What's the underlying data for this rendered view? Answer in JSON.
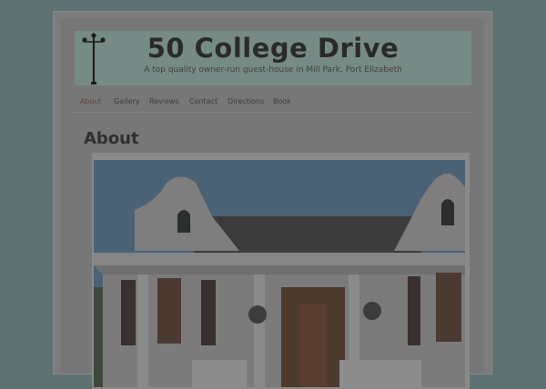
{
  "site": {
    "title": "50 College Drive",
    "tagline": "A top quality owner-run guest-house in Mill Park, Port Elizabeth"
  },
  "nav": {
    "items": [
      {
        "label": "About",
        "active": true
      },
      {
        "label": "Gallery",
        "active": false
      },
      {
        "label": "Reviews",
        "active": false
      },
      {
        "label": "Contact",
        "active": false
      },
      {
        "label": "Directions",
        "active": false
      },
      {
        "label": "Book",
        "active": false
      }
    ]
  },
  "page": {
    "heading": "About"
  },
  "icons": {
    "logo": "street-lamp-icon"
  },
  "colors": {
    "accent_link": "#6a4040",
    "header_bg": "#778b86",
    "page_bg": "#777777",
    "outer_bg": "#5f7272"
  }
}
